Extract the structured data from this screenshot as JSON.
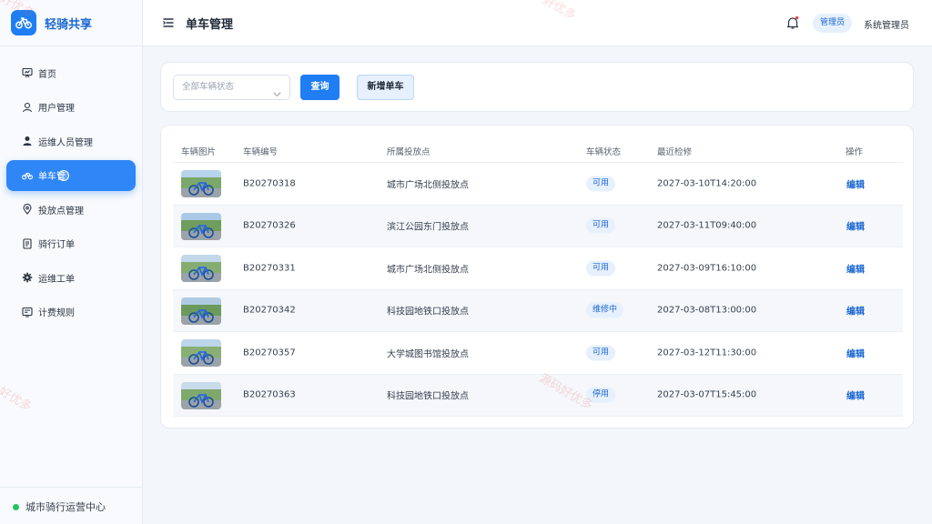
{
  "brand": {
    "name": "轻骑共享",
    "logo_icon": "bike-icon",
    "accent": "#1f7ef3"
  },
  "sidebar": {
    "items": [
      {
        "label": "首页",
        "icon": "dashboard-icon",
        "active": false
      },
      {
        "label": "用户管理",
        "icon": "user-icon",
        "active": false
      },
      {
        "label": "运维人员管理",
        "icon": "person-icon",
        "active": false
      },
      {
        "label": "单车管理",
        "display": "单车管",
        "icon": "bike-icon",
        "active": true
      },
      {
        "label": "投放点管理",
        "icon": "location-pin-icon",
        "active": false
      },
      {
        "label": "骑行订单",
        "icon": "document-icon",
        "active": false
      },
      {
        "label": "运维工单",
        "icon": "gear-icon",
        "active": false
      },
      {
        "label": "计费规则",
        "icon": "billing-icon",
        "active": false
      }
    ],
    "footer": {
      "label": "城市骑行运营中心",
      "status_color": "#22c55e"
    }
  },
  "header": {
    "title": "单车管理",
    "role": "管理员",
    "user": "系统管理员"
  },
  "filter": {
    "status_placeholder": "全部车辆状态",
    "query_label": "查询",
    "add_label": "新增单车"
  },
  "table": {
    "columns": [
      "车辆图片",
      "车辆编号",
      "所属投放点",
      "车辆状态",
      "最近检修",
      "操作"
    ],
    "rows": [
      {
        "id": "B20270318",
        "point": "城市广场北侧投放点",
        "status": "可用",
        "last_check": "2027-03-10T14:20:00",
        "action": "编辑"
      },
      {
        "id": "B20270326",
        "point": "滨江公园东门投放点",
        "status": "可用",
        "last_check": "2027-03-11T09:40:00",
        "action": "编辑"
      },
      {
        "id": "B20270331",
        "point": "城市广场北侧投放点",
        "status": "可用",
        "last_check": "2027-03-09T16:10:00",
        "action": "编辑"
      },
      {
        "id": "B20270342",
        "point": "科技园地铁口投放点",
        "status": "维修中",
        "last_check": "2027-03-08T13:00:00",
        "action": "编辑"
      },
      {
        "id": "B20270357",
        "point": "大学城图书馆投放点",
        "status": "可用",
        "last_check": "2027-03-12T11:30:00",
        "action": "编辑"
      },
      {
        "id": "B20270363",
        "point": "科技园地铁口投放点",
        "status": "停用",
        "last_check": "2027-03-07T15:45:00",
        "action": "编辑"
      }
    ]
  },
  "watermarks": [
    "好优多",
    "源码好优多",
    "好优多"
  ]
}
